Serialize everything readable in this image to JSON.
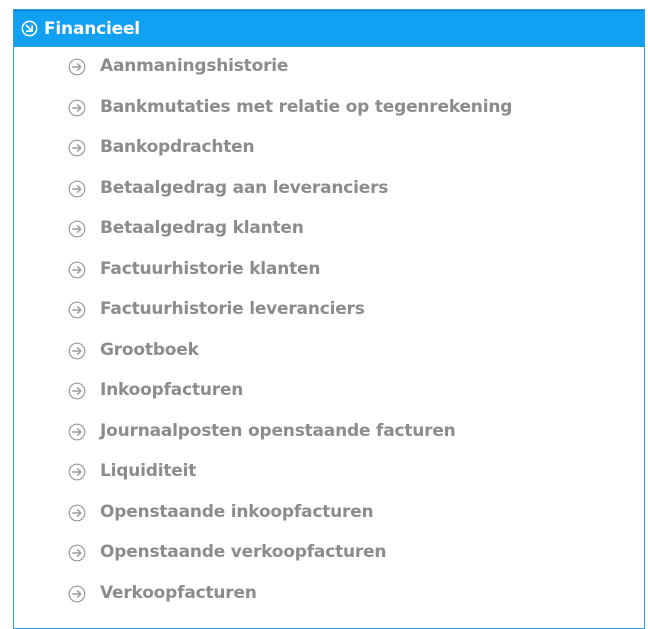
{
  "section": {
    "title": "Financieel",
    "icon": "collapse-arrow-icon",
    "accent_color": "#12a0f3",
    "border_color": "#29a3ee"
  },
  "menu": {
    "item_icon": "arrow-right-circle-icon",
    "text_color": "#8c8c8c",
    "items": [
      {
        "label": "Aanmaningshistorie"
      },
      {
        "label": "Bankmutaties met relatie op tegenrekening"
      },
      {
        "label": "Bankopdrachten"
      },
      {
        "label": "Betaalgedrag aan leveranciers"
      },
      {
        "label": "Betaalgedrag klanten"
      },
      {
        "label": "Factuurhistorie klanten"
      },
      {
        "label": "Factuurhistorie leveranciers"
      },
      {
        "label": "Grootboek"
      },
      {
        "label": "Inkoopfacturen"
      },
      {
        "label": "Journaalposten openstaande facturen"
      },
      {
        "label": "Liquiditeit"
      },
      {
        "label": "Openstaande inkoopfacturen"
      },
      {
        "label": "Openstaande verkoopfacturen"
      },
      {
        "label": "Verkoopfacturen"
      }
    ]
  }
}
